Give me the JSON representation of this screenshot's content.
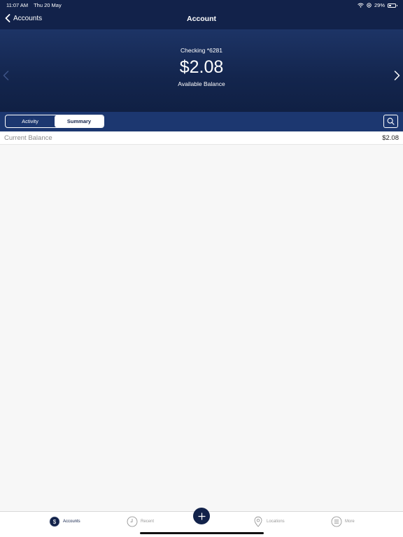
{
  "status_bar": {
    "time": "11:07 AM",
    "date": "Thu 20 May",
    "battery": "29%",
    "battery_level": 0.29
  },
  "nav": {
    "back_label": "Accounts",
    "title": "Account"
  },
  "hero": {
    "account_name": "Checking *6281",
    "balance": "$2.08",
    "balance_label": "Available Balance"
  },
  "tabs": {
    "activity": "Activity",
    "summary": "Summary",
    "selected": "Summary"
  },
  "summary": {
    "rows": [
      {
        "label": "Current Balance",
        "value": "$2.08"
      }
    ]
  },
  "tab_nav": {
    "items": [
      {
        "label": "Accounts",
        "icon": "accounts-dollar-icon",
        "active": true
      },
      {
        "label": "Recent",
        "icon": "clock-icon",
        "active": false
      },
      {
        "label": "Locations",
        "icon": "location-pin-icon",
        "active": false
      },
      {
        "label": "More",
        "icon": "menu-lines-icon",
        "active": false
      }
    ],
    "fab_icon": "plus-icon"
  },
  "colors": {
    "navy": "#12224a",
    "tab_bar": "#1c3770",
    "background": "#f7f7f7"
  }
}
